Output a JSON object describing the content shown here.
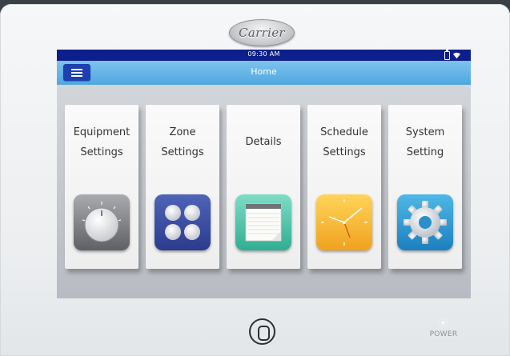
{
  "brand": {
    "logo_text": "Carrier"
  },
  "status_bar": {
    "time": "09:30  AM",
    "icons": [
      "battery-icon",
      "wifi-icon"
    ]
  },
  "header": {
    "title": "Home",
    "menu_icon": "hamburger-menu-icon"
  },
  "tiles": [
    {
      "line1": "Equipment",
      "line2": "Settings",
      "icon": "dial-knob-icon"
    },
    {
      "line1": "Zone",
      "line2": "Settings",
      "icon": "zones-grid-icon"
    },
    {
      "line1": "Details",
      "line2": "",
      "icon": "notepad-icon"
    },
    {
      "line1": "Schedule",
      "line2": "Settings",
      "icon": "clock-icon"
    },
    {
      "line1": "System",
      "line2": "Setting",
      "icon": "gear-icon"
    }
  ],
  "device": {
    "power_label": "POWER",
    "home_button_icon": "home-button-icon"
  },
  "colors": {
    "status_bar": "#0c1f8a",
    "title_bar": "#4ea7e0",
    "menu_button": "#1d3fb0"
  }
}
